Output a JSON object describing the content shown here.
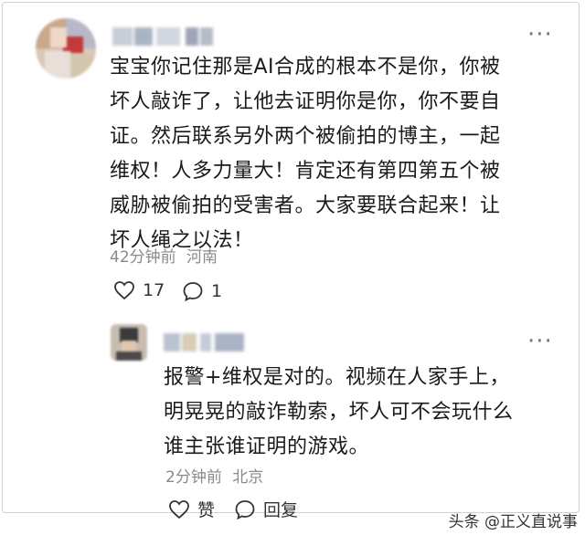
{
  "comments": [
    {
      "lines": [
        "宝宝你记住那是AI合成的根本不是你，你被",
        "坏人敲诈了，让他去证明你是你，你不要自",
        "证。然后联系另外两个被偷拍的博主，一起",
        "维权！人多力量大！肯定还有第四第五个被",
        "威胁被偷拍的受害者。大家要联合起来！让",
        "坏人绳之以法！"
      ],
      "time": "42分钟前",
      "location": "河南",
      "like_count": "17",
      "reply_count": "1",
      "more_label": "···"
    },
    {
      "lines": [
        "报警+维权是对的。视频在人家手上，",
        "明晃晃的敲诈勒索，坏人可不会玩什么",
        "谁主张谁证明的游戏。"
      ],
      "time": "2分钟前",
      "location": "北京",
      "like_label": "赞",
      "reply_label": "回复",
      "more_label": "···"
    }
  ],
  "watermark": "头条 @正义直说事",
  "icons": [
    "heart-icon",
    "comment-bubble-icon",
    "more-icon"
  ]
}
